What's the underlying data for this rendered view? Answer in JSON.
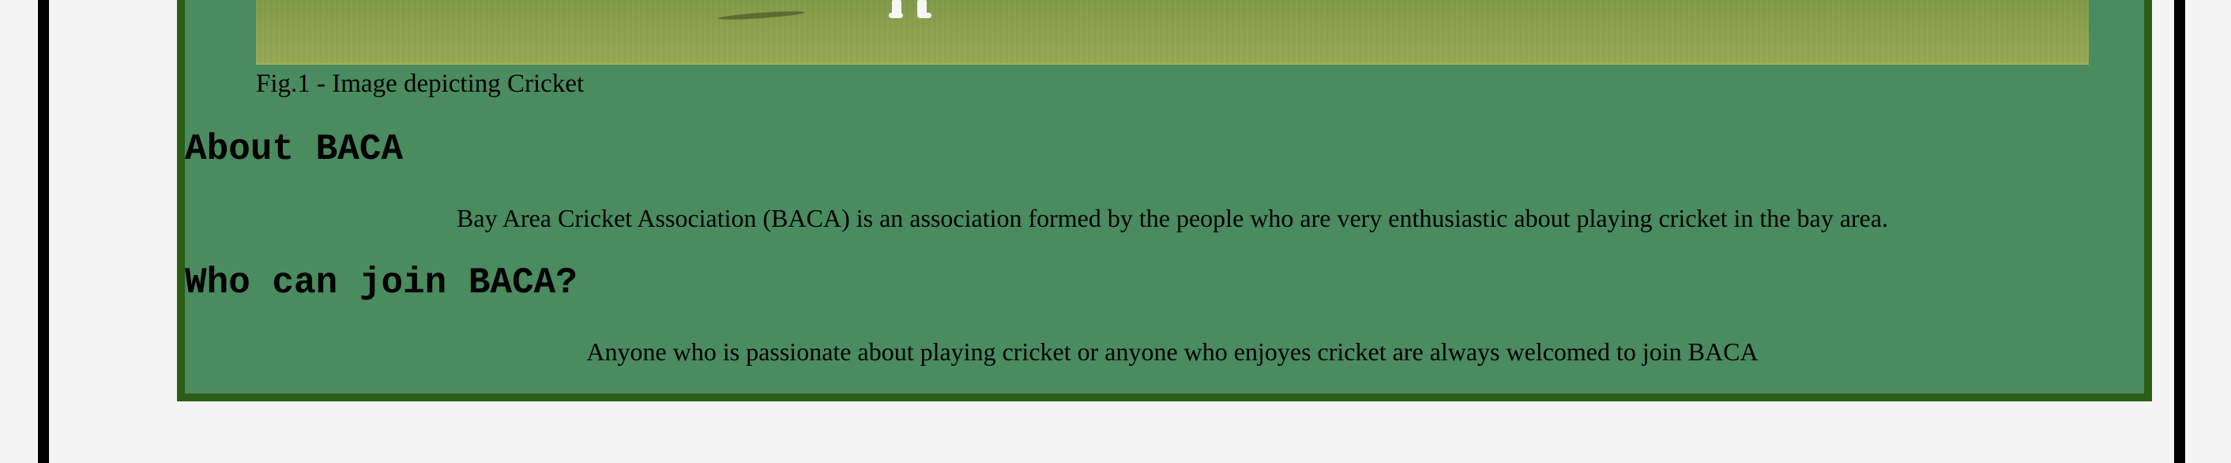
{
  "figure": {
    "caption": "Fig.1 - Image depicting Cricket"
  },
  "about": {
    "heading": "About BACA",
    "text": "Bay Area Cricket Association (BACA) is an association formed by the people who are very enthusiastic about playing cricket in the bay area."
  },
  "join": {
    "heading": "Who can join BACA?",
    "text": "Anyone who is passionate about playing cricket or anyone who enjoyes cricket are always welcomed to join BACA"
  },
  "colors": {
    "page_background": "#f4f4f4",
    "outer_border": "#000000",
    "panel_background": "#4a8b5f",
    "panel_border": "#2a5e16",
    "grass": "#8ba24e"
  }
}
